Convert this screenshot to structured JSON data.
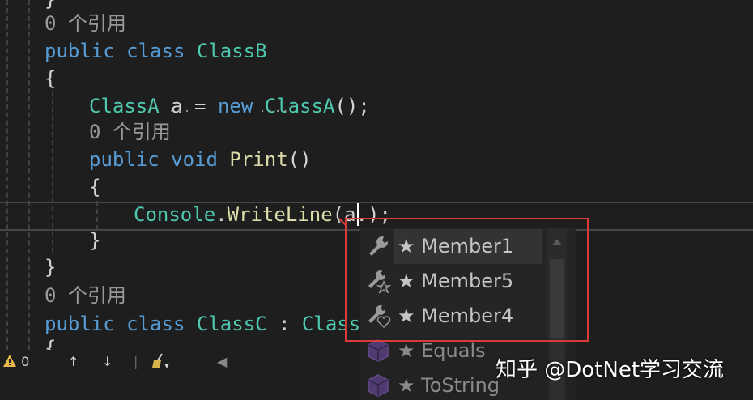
{
  "code": {
    "lines": [
      {
        "ref": "0 个引用"
      },
      {
        "kw1": "public",
        "kw2": "class",
        "name": "ClassB"
      },
      {
        "text": "{"
      },
      {
        "type": "ClassA",
        "var": "a",
        "op": " = ",
        "kw": "new",
        "ctor": "ClassA",
        "tail": "();"
      },
      {
        "ref": "0 个引用"
      },
      {
        "kw1": "public",
        "kw2": "void",
        "fn": "Print",
        "tail": "()"
      },
      {
        "text": "{"
      },
      {
        "cls": "Console",
        "dot": ".",
        "fn": "WriteLine",
        "args": "(a.",
        "tail": ");"
      },
      {
        "text": "}"
      },
      {
        "text": "}"
      },
      {
        "ref": "0 个引用"
      },
      {
        "kw1": "public",
        "kw2": "class",
        "name": "ClassC",
        "sep": " : ",
        "base": "ClassA"
      },
      {
        "text": "{"
      }
    ],
    "partial_top": "}"
  },
  "statusbar": {
    "warnings": "0",
    "up": "↑",
    "down": "↓",
    "left": "◀"
  },
  "completion": {
    "items": [
      {
        "label": "★ Member1",
        "icon": "wrench-icon",
        "selected": true
      },
      {
        "label": "★ Member5",
        "icon": "wrench-star-icon",
        "selected": false
      },
      {
        "label": "★ Member4",
        "icon": "wrench-heart-icon",
        "selected": false
      },
      {
        "label": "★ Equals",
        "icon": "method-cube-icon",
        "selected": false
      },
      {
        "label": "★ ToString",
        "icon": "method-cube-icon",
        "selected": false
      }
    ],
    "highlight_color": "#d93a3a"
  },
  "watermark": "知乎 @DotNet学习交流",
  "colors": {
    "keyword": "#569cd6",
    "type": "#4ec9b0",
    "method": "#dcdcaa",
    "reference": "#999999"
  }
}
